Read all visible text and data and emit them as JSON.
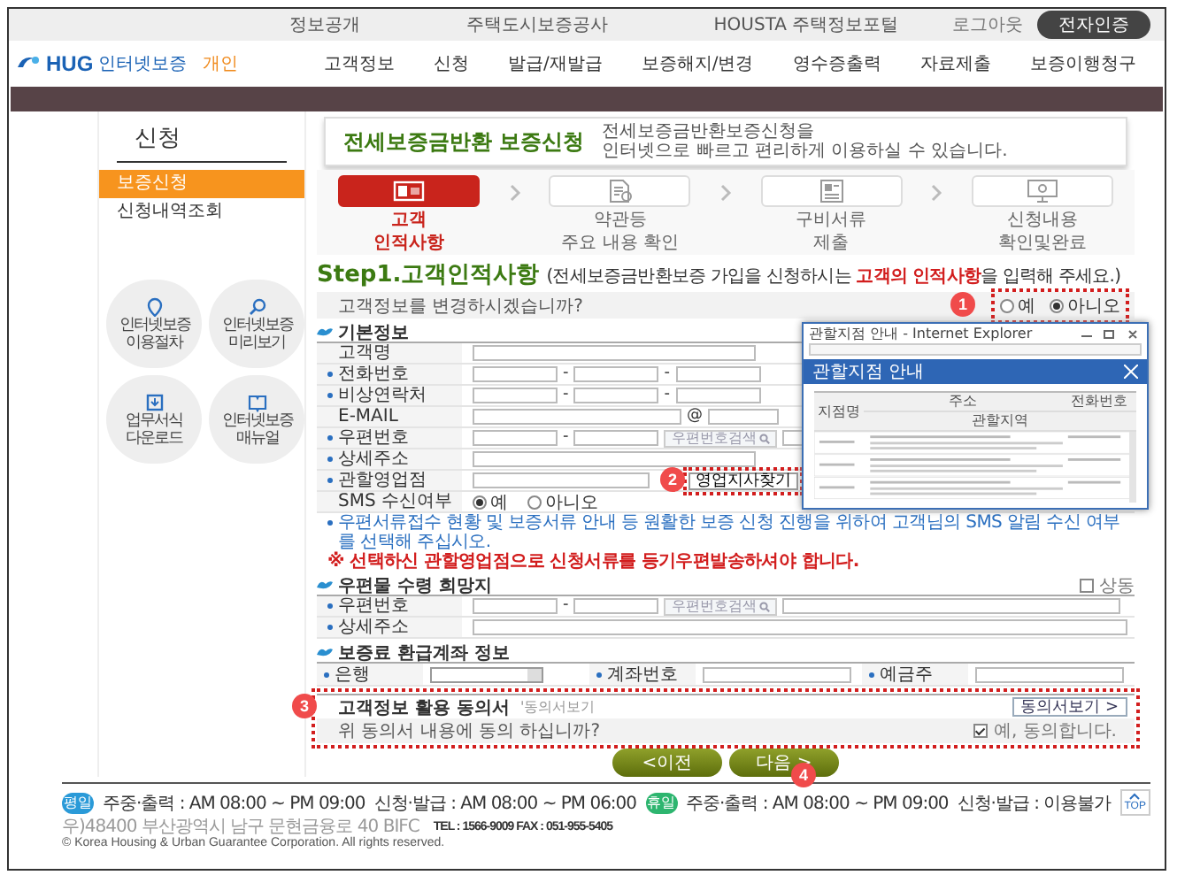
{
  "top_links": [
    "정보공개",
    "주택도시보증공사",
    "HOUSTA 주택정보포털"
  ],
  "account": {
    "link": "로그아웃",
    "button": "전자인증"
  },
  "logo": {
    "brand": "HUG",
    "name": "인터넷보증",
    "tag": "개인"
  },
  "nav": [
    "고객정보",
    "신청",
    "발급/재발급",
    "보증해지/변경",
    "영수증출력",
    "자료제출",
    "보증이행청구"
  ],
  "sidebar": {
    "title": "신청",
    "items": [
      {
        "label": "보증신청",
        "selected": true
      },
      {
        "label": "신청내역조회",
        "selected": false
      }
    ],
    "shortcuts": [
      {
        "kind": "pin",
        "lines": [
          "인터넷보증",
          "이용절차"
        ]
      },
      {
        "kind": "search",
        "lines": [
          "인터넷보증",
          "미리보기"
        ]
      },
      {
        "kind": "download",
        "lines": [
          "업무서식",
          "다운로드"
        ]
      },
      {
        "kind": "book",
        "lines": [
          "인터넷보증",
          "매뉴얼"
        ]
      }
    ]
  },
  "banner": {
    "title": "전세보증금반환 보증신청",
    "description": [
      "전세보증금반환보증신청을",
      "인터넷으로 빠르고 편리하게 이용하실 수 있습니다."
    ]
  },
  "steps": [
    {
      "kind": "id-card",
      "label": [
        "고객",
        "인적사항"
      ],
      "selected": true
    },
    {
      "kind": "document",
      "label": [
        "약관등",
        "주요 내용 확인"
      ],
      "selected": false
    },
    {
      "kind": "form",
      "label": [
        "구비서류",
        "제출"
      ],
      "selected": false
    },
    {
      "kind": "monitor",
      "label": [
        "신청내용",
        "확인및완료"
      ],
      "selected": false
    }
  ],
  "step_heading": {
    "title": "Step1.고객인적사항",
    "note": "(전세보증금반환보증 가입을 신청하시는 **고객의 인적사항**을 입력해 주세요.)"
  },
  "change_question": {
    "text": "고객정보를 변경하시겠습니까?",
    "options": [
      {
        "label": "예",
        "selected": false
      },
      {
        "label": "아니오",
        "selected": true
      }
    ]
  },
  "basic_info": {
    "title": "기본정보",
    "rows": [
      {
        "label": "고객명",
        "required": false,
        "kind": "text"
      },
      {
        "label": "전화번호",
        "required": true,
        "kind": "phone",
        "separators": [
          "-",
          "-"
        ]
      },
      {
        "label": "비상연락처",
        "required": true,
        "kind": "phone",
        "separators": [
          "-",
          "-"
        ]
      },
      {
        "label": "E-MAIL",
        "required": false,
        "kind": "email",
        "separators": [
          "@"
        ]
      },
      {
        "label": "우편번호",
        "required": true,
        "kind": "zipcode",
        "separators": [
          "-"
        ],
        "button": "우편번호검색"
      },
      {
        "label": "상세주소",
        "required": true,
        "kind": "text"
      },
      {
        "label": "관할영업점",
        "required": true,
        "kind": "branch",
        "button": "영업지사찾기"
      },
      {
        "label": "SMS 수신여부",
        "required": false,
        "kind": "radio",
        "options": [
          {
            "label": "예",
            "selected": true
          },
          {
            "label": "아니오",
            "selected": false
          }
        ]
      }
    ]
  },
  "notes": [
    {
      "kind": "info",
      "text": "우편서류접수 현황 및 보증서류 안내 등 원활한 보증 신청 진행을 위하여 고객님의 SMS 알림 수신 여부를 선택해 주십시오."
    },
    {
      "kind": "warning",
      "text": "※ 선택하신 관할영업점으로 신청서류를 등기우편발송하셔야 합니다."
    }
  ],
  "mailing": {
    "title": "우편물 수령 희망지",
    "same_as_above": {
      "label": "상동",
      "checked": false
    },
    "rows": [
      {
        "label": "우편번호",
        "required": true,
        "kind": "zipcode",
        "separators": [
          "-"
        ],
        "button": "우편번호검색"
      },
      {
        "label": "상세주소",
        "required": true,
        "kind": "text"
      }
    ]
  },
  "refund_account": {
    "title": "보증료 환급계좌 정보",
    "fields": [
      {
        "label": "은행",
        "kind": "select"
      },
      {
        "label": "계좌번호",
        "kind": "text"
      },
      {
        "label": "예금주",
        "kind": "text"
      }
    ]
  },
  "consent": {
    "title": "고객정보 활용 동의서",
    "hint": "'동의서보기",
    "button": "동의서보기 >",
    "question": "위 동의서 내용에 동의 하십니까?",
    "agree": {
      "label": "예, 동의합니다.",
      "checked": true
    }
  },
  "buttons": [
    {
      "label": "<이전"
    },
    {
      "label": "다음 >"
    }
  ],
  "popup": {
    "title": "관할지점 안내 - Internet Explorer",
    "header": "관할지점 안내",
    "columns": [
      "지점명",
      "주소",
      "전화번호"
    ],
    "subheader": "관할지역"
  },
  "annotations": [
    "1",
    "2",
    "3",
    "4"
  ],
  "footer": {
    "hours": [
      {
        "badge": "평일",
        "color": "#2a9ad8",
        "items": [
          "주중·출력 : AM 08:00 ~ PM 09:00",
          "신청·발급 : AM 08:00 ~ PM 06:00"
        ]
      },
      {
        "badge": "휴일",
        "color": "#2db56f",
        "items": [
          "주중·출력 : AM 08:00 ~ PM 09:00",
          "신청·발급 : 이용불가"
        ]
      }
    ],
    "address": "우)48400 부산광역시 남구 문현금융로 40 BIFC",
    "contact": "TEL : 1566-9009   FAX : 051-955-5405",
    "copyright": "© Korea Housing & Urban Guarantee Corporation. All rights reserved.",
    "top": "TOP"
  }
}
